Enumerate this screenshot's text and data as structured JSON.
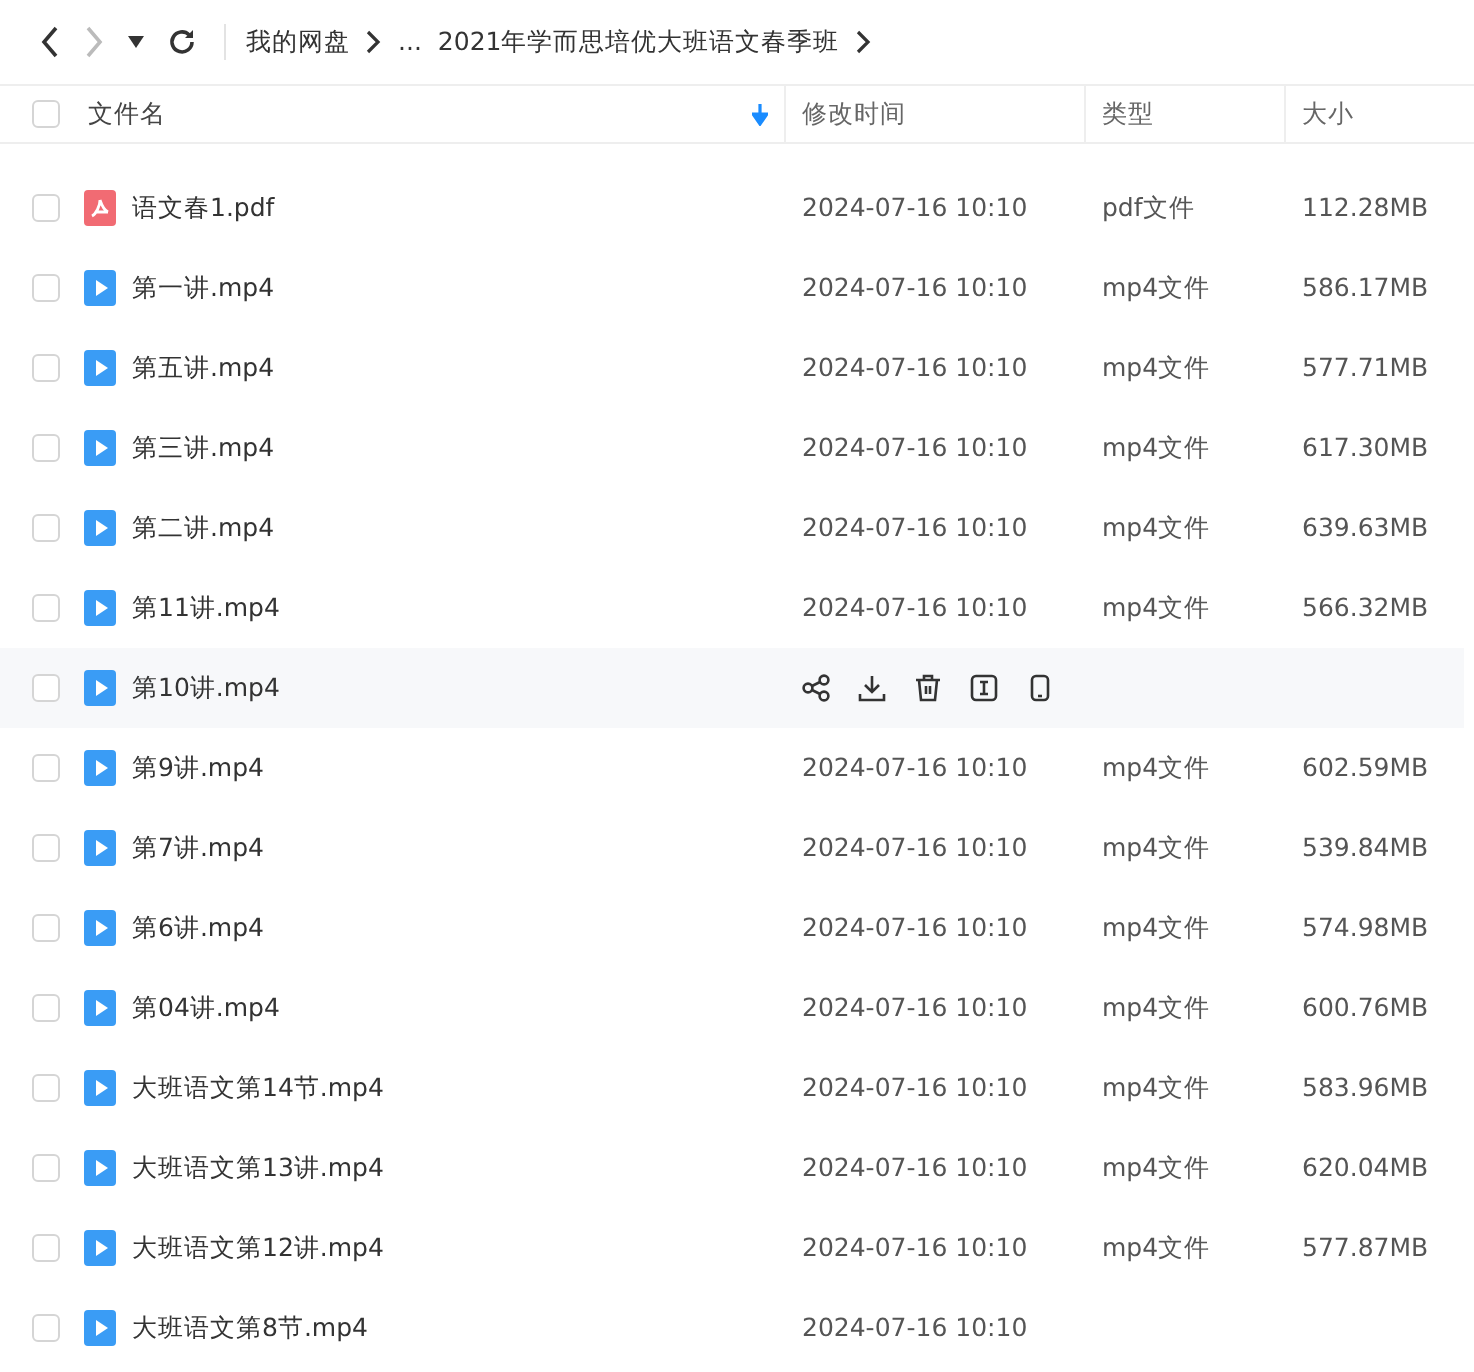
{
  "toolbar": {
    "breadcrumb": [
      "我的网盘",
      "...",
      "2021年学而思培优大班语文春季班"
    ]
  },
  "table": {
    "select_all_checked": false,
    "columns": [
      {
        "label": "文件名",
        "sorted": true
      },
      {
        "label": "修改时间",
        "sorted": false
      },
      {
        "label": "类型",
        "sorted": false
      },
      {
        "label": "大小",
        "sorted": false
      }
    ],
    "rows": [
      {
        "kind": "pdf",
        "name": "语文春1.pdf",
        "time": "2024-07-16 10:10",
        "type": "pdf文件",
        "size": "112.28MB",
        "checked": false,
        "hovered": false
      },
      {
        "kind": "video",
        "name": "第一讲.mp4",
        "time": "2024-07-16 10:10",
        "type": "mp4文件",
        "size": "586.17MB",
        "checked": false,
        "hovered": false
      },
      {
        "kind": "video",
        "name": "第五讲.mp4",
        "time": "2024-07-16 10:10",
        "type": "mp4文件",
        "size": "577.71MB",
        "checked": false,
        "hovered": false
      },
      {
        "kind": "video",
        "name": "第三讲.mp4",
        "time": "2024-07-16 10:10",
        "type": "mp4文件",
        "size": "617.30MB",
        "checked": false,
        "hovered": false
      },
      {
        "kind": "video",
        "name": "第二讲.mp4",
        "time": "2024-07-16 10:10",
        "type": "mp4文件",
        "size": "639.63MB",
        "checked": false,
        "hovered": false
      },
      {
        "kind": "video",
        "name": "第11讲.mp4",
        "time": "2024-07-16 10:10",
        "type": "mp4文件",
        "size": "566.32MB",
        "checked": false,
        "hovered": false
      },
      {
        "kind": "video",
        "name": "第10讲.mp4",
        "checked": false,
        "hovered": true
      },
      {
        "kind": "video",
        "name": "第9讲.mp4",
        "time": "2024-07-16 10:10",
        "type": "mp4文件",
        "size": "602.59MB",
        "checked": false,
        "hovered": false
      },
      {
        "kind": "video",
        "name": "第7讲.mp4",
        "time": "2024-07-16 10:10",
        "type": "mp4文件",
        "size": "539.84MB",
        "checked": false,
        "hovered": false
      },
      {
        "kind": "video",
        "name": "第6讲.mp4",
        "time": "2024-07-16 10:10",
        "type": "mp4文件",
        "size": "574.98MB",
        "checked": false,
        "hovered": false
      },
      {
        "kind": "video",
        "name": "第04讲.mp4",
        "time": "2024-07-16 10:10",
        "type": "mp4文件",
        "size": "600.76MB",
        "checked": false,
        "hovered": false
      },
      {
        "kind": "video",
        "name": "大班语文第14节.mp4",
        "time": "2024-07-16 10:10",
        "type": "mp4文件",
        "size": "583.96MB",
        "checked": false,
        "hovered": false
      },
      {
        "kind": "video",
        "name": "大班语文第13讲.mp4",
        "time": "2024-07-16 10:10",
        "type": "mp4文件",
        "size": "620.04MB",
        "checked": false,
        "hovered": false
      },
      {
        "kind": "video",
        "name": "大班语文第12讲.mp4",
        "time": "2024-07-16 10:10",
        "type": "mp4文件",
        "size": "577.87MB",
        "checked": false,
        "hovered": false
      },
      {
        "kind": "video",
        "name": "大班语文第8节.mp4",
        "time": "2024-07-16 10:10",
        "checked": false,
        "hovered": false
      }
    ]
  }
}
